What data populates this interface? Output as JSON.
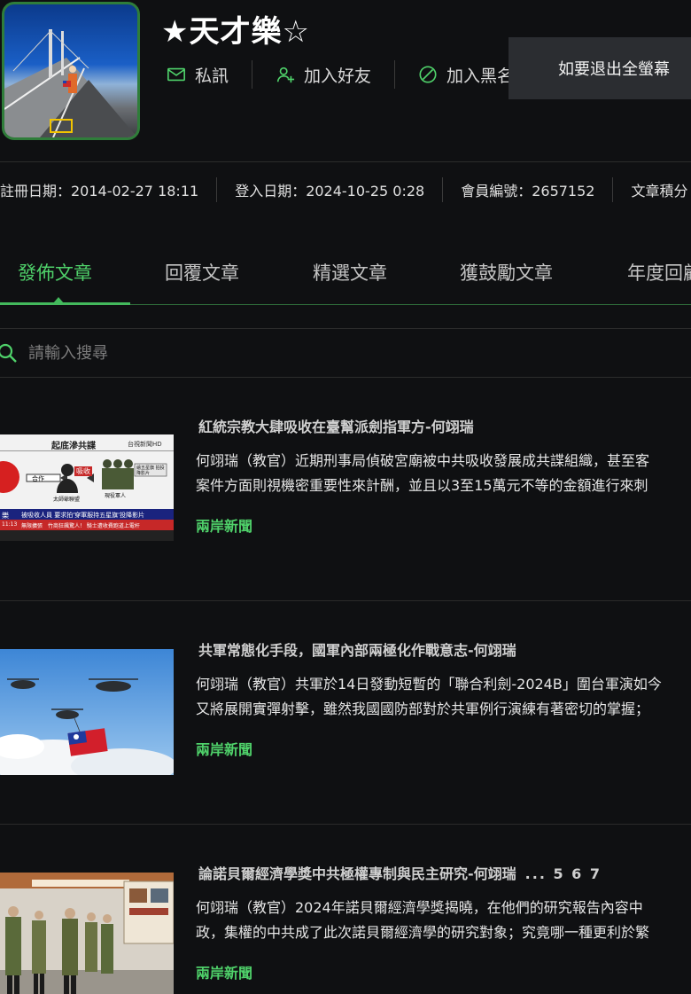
{
  "profile": {
    "username": "★天才樂☆",
    "actions": {
      "message": "私訊",
      "add_friend": "加入好友",
      "blacklist": "加入黑名單"
    }
  },
  "toast": {
    "text": "如要退出全螢幕"
  },
  "meta": {
    "register": "註冊日期：2014-02-27 18:11",
    "login": "登入日期：2024-10-25 0:28",
    "member_id": "會員編號：2657152",
    "score": "文章積分"
  },
  "tabs": [
    "發佈文章",
    "回覆文章",
    "精選文章",
    "獲鼓勵文章",
    "年度回顧"
  ],
  "search": {
    "placeholder": "請輸入搜尋"
  },
  "articles": [
    {
      "title": "紅統宗教大肆吸收在臺幫派劍指軍方-何翊瑞",
      "excerpt1": "何翊瑞（教官）近期刑事局偵破宮廟被中共吸收發展成共諜組織，甚至客",
      "excerpt2": "案件方面則視機密重要性來計酬，並且以3至15萬元不等的金額進行來刺",
      "category": "兩岸新聞",
      "thumb": {
        "header": "起底滲共諜",
        "logo": "台視新聞HD",
        "tag_coop": "合作",
        "tag_absorb": "吸收",
        "caption1": "太師爺聯盟",
        "caption2": "現役軍人",
        "caption3": "繪五星旗 拍投降影片",
        "headline": "被吸收人員 要求拍'穿軍服持五星旗'投降影片",
        "ticker": "無限擴張　竹商狂飆驚人！ 騎士遭收費跑道上電杆",
        "side": "樂",
        "time": "11:13"
      }
    },
    {
      "title": "共軍常態化手段，國軍內部兩極化作戰意志-何翊瑞",
      "excerpt1": "何翊瑞（教官）共軍於14日發動短暫的「聯合利劍-2024B」圍台軍演如今",
      "excerpt2": "又將展開實彈射擊，雖然我國國防部對於共軍例行演練有著密切的掌握；",
      "category": "兩岸新聞"
    },
    {
      "title": "論諾貝爾經濟學獎中共極權專制與民主研究-何翊瑞",
      "pager": "... 5 6 7",
      "excerpt1": "何翊瑞（教官）2024年諾貝爾經濟學獎揭曉，在他們的研究報告內容中",
      "excerpt2": "政，集權的中共成了此次諾貝爾經濟學的研究對象；究竟哪一種更利於繁",
      "category": "兩岸新聞"
    }
  ],
  "colors": {
    "accent": "#4fd16a",
    "background": "#0f1012",
    "toast": "#2b2d31"
  }
}
